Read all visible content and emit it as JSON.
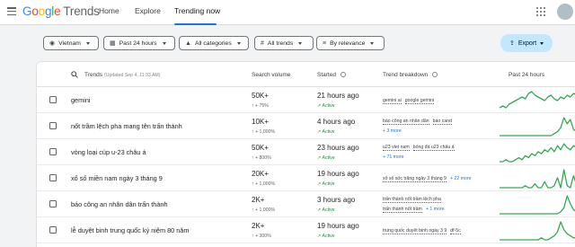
{
  "header": {
    "logo_google": [
      "G",
      "o",
      "o",
      "g",
      "l",
      "e"
    ],
    "logo_trends": "Trends",
    "nav": {
      "home": "Home",
      "explore": "Explore",
      "trending": "Trending now"
    }
  },
  "filters": {
    "country": "Vietnam",
    "time": "Past 24 hours",
    "category": "All categories",
    "trends": "All trends",
    "sort": "By relevance",
    "export": "Export"
  },
  "table": {
    "columns": {
      "trends": "Trends",
      "updated": "(Updated Sep 4, 11:33 AM)",
      "volume": "Search volume",
      "started": "Started",
      "breakdown": "Trend breakdown",
      "past": "Past 24 hours"
    },
    "rows": [
      {
        "title": "gemini",
        "volume": "50K+",
        "change": "75%",
        "started": "21 hours ago",
        "status": "Active",
        "breakdown": [
          "gemini ai",
          "google gemini"
        ],
        "more": "",
        "spark": [
          1,
          2,
          1,
          3,
          4,
          5,
          6,
          7,
          6,
          9,
          10,
          8,
          7,
          6,
          5,
          7,
          8,
          6,
          5,
          7,
          6,
          8,
          7,
          9,
          8
        ]
      },
      {
        "title": "nốt trầm lệch pha mang tên trấn thành",
        "volume": "10K+",
        "change": "1,000%",
        "started": "4 hours ago",
        "status": "Active",
        "breakdown": [
          "báo công an nhân dân",
          "báo cand"
        ],
        "more": "+ 3 more",
        "spark": [
          0,
          0,
          0,
          0,
          0,
          0,
          0,
          0,
          0,
          0,
          0,
          0,
          0,
          0,
          0,
          0,
          0,
          1,
          2,
          4,
          9,
          6,
          8,
          3,
          2
        ]
      },
      {
        "title": "vòng loại cúp u-23 châu á",
        "volume": "50K+",
        "change": "800%",
        "started": "23 hours ago",
        "status": "Active",
        "breakdown": [
          "u23 viet nam",
          "bóng đá u23 châu á"
        ],
        "more": "+ 71 more",
        "spark": [
          0,
          0,
          1,
          0,
          0,
          1,
          2,
          1,
          3,
          2,
          4,
          3,
          5,
          4,
          6,
          5,
          7,
          5,
          8,
          6,
          9,
          7,
          6,
          8,
          7
        ]
      },
      {
        "title": "xổ số miền nam ngày 3 tháng 9",
        "volume": "20K+",
        "change": "1,000%",
        "started": "19 hours ago",
        "status": "Active",
        "breakdown": [
          "xổ số sóc trăng ngày 3 tháng 9"
        ],
        "more": "+ 22 more",
        "spark": [
          0,
          0,
          0,
          0,
          0,
          0,
          0,
          0,
          1,
          0,
          0,
          2,
          0,
          0,
          3,
          0,
          0,
          1,
          5,
          0,
          9,
          1,
          0,
          6,
          1
        ]
      },
      {
        "title": "báo công an nhân dân trấn thành",
        "volume": "2K+",
        "change": "1,000%",
        "started": "3 hours ago",
        "status": "Active",
        "breakdown": [
          "trấn thành nốt trầm lệch pha",
          "trấn thành nốt trầm"
        ],
        "more": "+ 1 more",
        "spark": [
          0,
          0,
          0,
          0,
          0,
          0,
          0,
          0,
          0,
          0,
          0,
          0,
          0,
          0,
          0,
          0,
          0,
          0,
          0,
          1,
          3,
          9,
          5,
          2,
          1
        ]
      },
      {
        "title": "lễ duyệt binh trung quốc kỷ niệm 80 năm",
        "volume": "2K+",
        "change": "300%",
        "started": "19 hours ago",
        "status": "Active",
        "breakdown": [
          "trung quốc duyệt binh ngày 3 9",
          "df-5c"
        ],
        "more": "",
        "spark": [
          0,
          0,
          0,
          0,
          0,
          0,
          0,
          0,
          0,
          0,
          0,
          0,
          0,
          1,
          0,
          0,
          1,
          2,
          4,
          9,
          5,
          3,
          2,
          1,
          1
        ]
      }
    ]
  },
  "colors": {
    "accent": "#1a73e8",
    "active": "#1e8e3e",
    "spark": "#34a853",
    "export_bg": "#c2e7ff"
  }
}
